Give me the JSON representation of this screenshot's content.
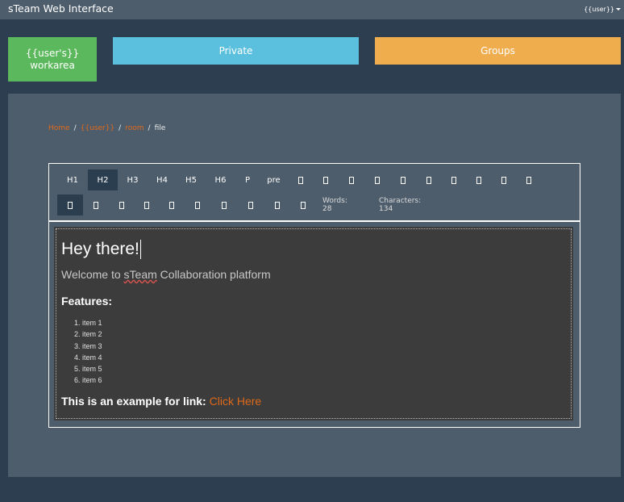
{
  "navbar": {
    "brand": "sTeam Web Interface",
    "user_menu": "{{user}}"
  },
  "tiles": {
    "workarea_line1": "{{user's}}",
    "workarea_line2": "workarea",
    "private": "Private",
    "groups": "Groups"
  },
  "breadcrumb": {
    "home": "Home",
    "user": "{{user}}",
    "room": "room",
    "file": "file",
    "separator": "/"
  },
  "toolbar": {
    "headings": [
      "H1",
      "H2",
      "H3",
      "H4",
      "H5",
      "H6",
      "P",
      "pre"
    ],
    "active_heading": "H2",
    "row1_icons": [
      "bold-icon",
      "italic-icon",
      "underline-icon",
      "strikethrough-icon",
      "ordered-list-icon",
      "unordered-list-icon",
      "indent-icon",
      "outdent-icon",
      "align-left-icon",
      "align-center-icon"
    ],
    "row2_icons": [
      "align-right-icon",
      "justify-icon",
      "link-icon",
      "unlink-icon",
      "image-icon",
      "table-icon",
      "horizontal-rule-icon",
      "undo-icon",
      "redo-icon",
      "code-icon"
    ],
    "words": "Words: 28",
    "characters": "Characters: 134"
  },
  "document": {
    "heading": "Hey there!",
    "subtitle_before": "Welcome to ",
    "subtitle_misspelled": "sTeam",
    "subtitle_after": " Collaboration platform",
    "features_heading": "Features:",
    "items": [
      "item 1",
      "item 2",
      "item 3",
      "item 4",
      "item 5",
      "item 6"
    ],
    "link_prefix": "This is an example for link: ",
    "link_text": "Click Here"
  },
  "colors": {
    "navbar": "#4e5d6c",
    "background": "#2c3e50",
    "workarea_tile": "#5cb85c",
    "private_tile": "#5bc0de",
    "groups_tile": "#f0ad4e",
    "link": "#df691a",
    "editor_content": "#3c3c3c"
  }
}
